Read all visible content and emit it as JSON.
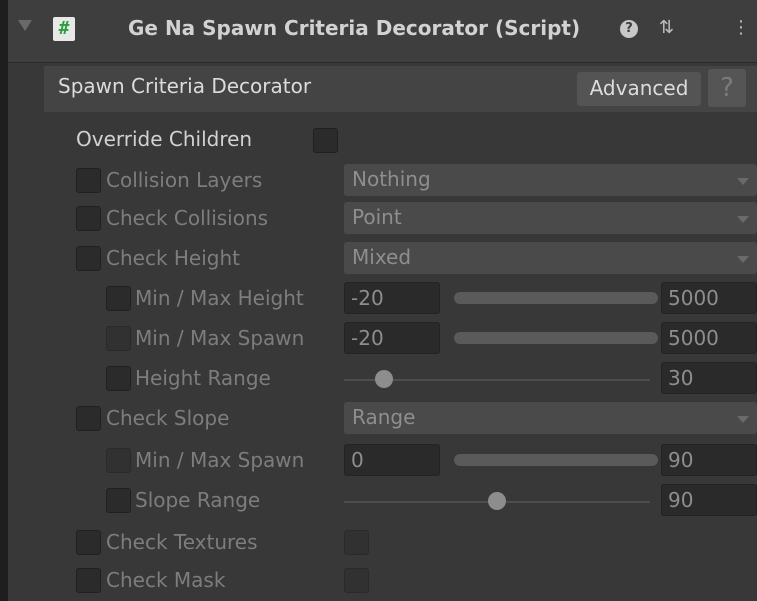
{
  "header": {
    "title": "Ge Na Spawn Criteria Decorator (Script)",
    "script_glyph": "#",
    "help_glyph": "?",
    "settings_glyph": "⇅",
    "menu_glyph": "⋮"
  },
  "section": {
    "label": "Spawn Criteria Decorator",
    "advanced_label": "Advanced",
    "help_label": "?"
  },
  "override": {
    "label": "Override Children"
  },
  "collision_layers": {
    "label": "Collision Layers",
    "value": "Nothing"
  },
  "check_collisions": {
    "label": "Check Collisions",
    "value": "Point"
  },
  "check_height": {
    "label": "Check Height",
    "value": "Mixed",
    "min_max_height": {
      "label": "Min / Max Height",
      "min": "-20",
      "max": "5000"
    },
    "min_max_spawn": {
      "label": "Min / Max Spawn",
      "min": "-20",
      "max": "5000"
    },
    "height_range": {
      "label": "Height Range",
      "value": "30",
      "fraction": 0.13
    }
  },
  "check_slope": {
    "label": "Check Slope",
    "value": "Range",
    "min_max_spawn": {
      "label": "Min / Max Spawn",
      "min": "0",
      "max": "90"
    },
    "slope_range": {
      "label": "Slope Range",
      "value": "90",
      "fraction": 0.5
    }
  },
  "check_textures": {
    "label": "Check Textures"
  },
  "check_mask": {
    "label": "Check Mask"
  },
  "colors": {
    "panel_bg": "#383838",
    "header_bg": "#3e3e3e",
    "field_bg": "#4a4a4a",
    "script_icon_green": "#2b9f3b"
  }
}
